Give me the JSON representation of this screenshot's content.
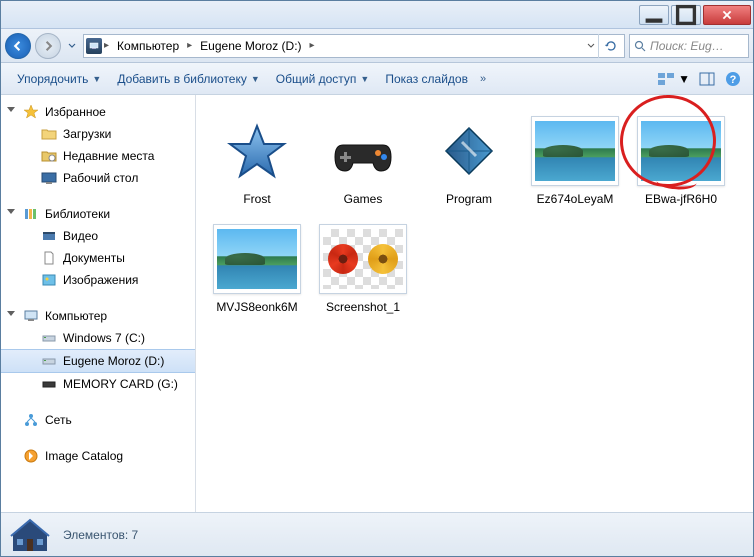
{
  "window": {
    "search_placeholder": "Поиск: Eug…"
  },
  "breadcrumbs": {
    "root": "Компьютер",
    "drive": "Eugene Moroz (D:)"
  },
  "toolbar": {
    "organize": "Упорядочить",
    "add_library": "Добавить в библиотеку",
    "share": "Общий доступ",
    "slideshow": "Показ слайдов"
  },
  "sidebar": {
    "favorites": {
      "label": "Избранное",
      "items": [
        "Загрузки",
        "Недавние места",
        "Рабочий стол"
      ]
    },
    "libraries": {
      "label": "Библиотеки",
      "items": [
        "Видео",
        "Документы",
        "Изображения"
      ]
    },
    "computer": {
      "label": "Компьютер",
      "items": [
        "Windows 7 (C:)",
        "Eugene Moroz (D:)",
        "MEMORY CARD (G:)"
      ],
      "selected_index": 1
    },
    "network": {
      "label": "Сеть"
    },
    "image_catalog": {
      "label": "Image Catalog"
    }
  },
  "items": [
    {
      "name": "Frost",
      "type": "folder",
      "icon": "star"
    },
    {
      "name": "Games",
      "type": "folder",
      "icon": "gamepad"
    },
    {
      "name": "Program",
      "type": "folder",
      "icon": "diamond"
    },
    {
      "name": "Ez674oLeyaM",
      "type": "image",
      "icon": "photo",
      "annotated": true
    },
    {
      "name": "EBwa-jfR6H0",
      "type": "image",
      "icon": "photo"
    },
    {
      "name": "MVJS8eonk6M",
      "type": "image",
      "icon": "photo"
    },
    {
      "name": "Screenshot_1",
      "type": "image",
      "icon": "flower"
    }
  ],
  "status": {
    "label": "Элементов: 7"
  }
}
